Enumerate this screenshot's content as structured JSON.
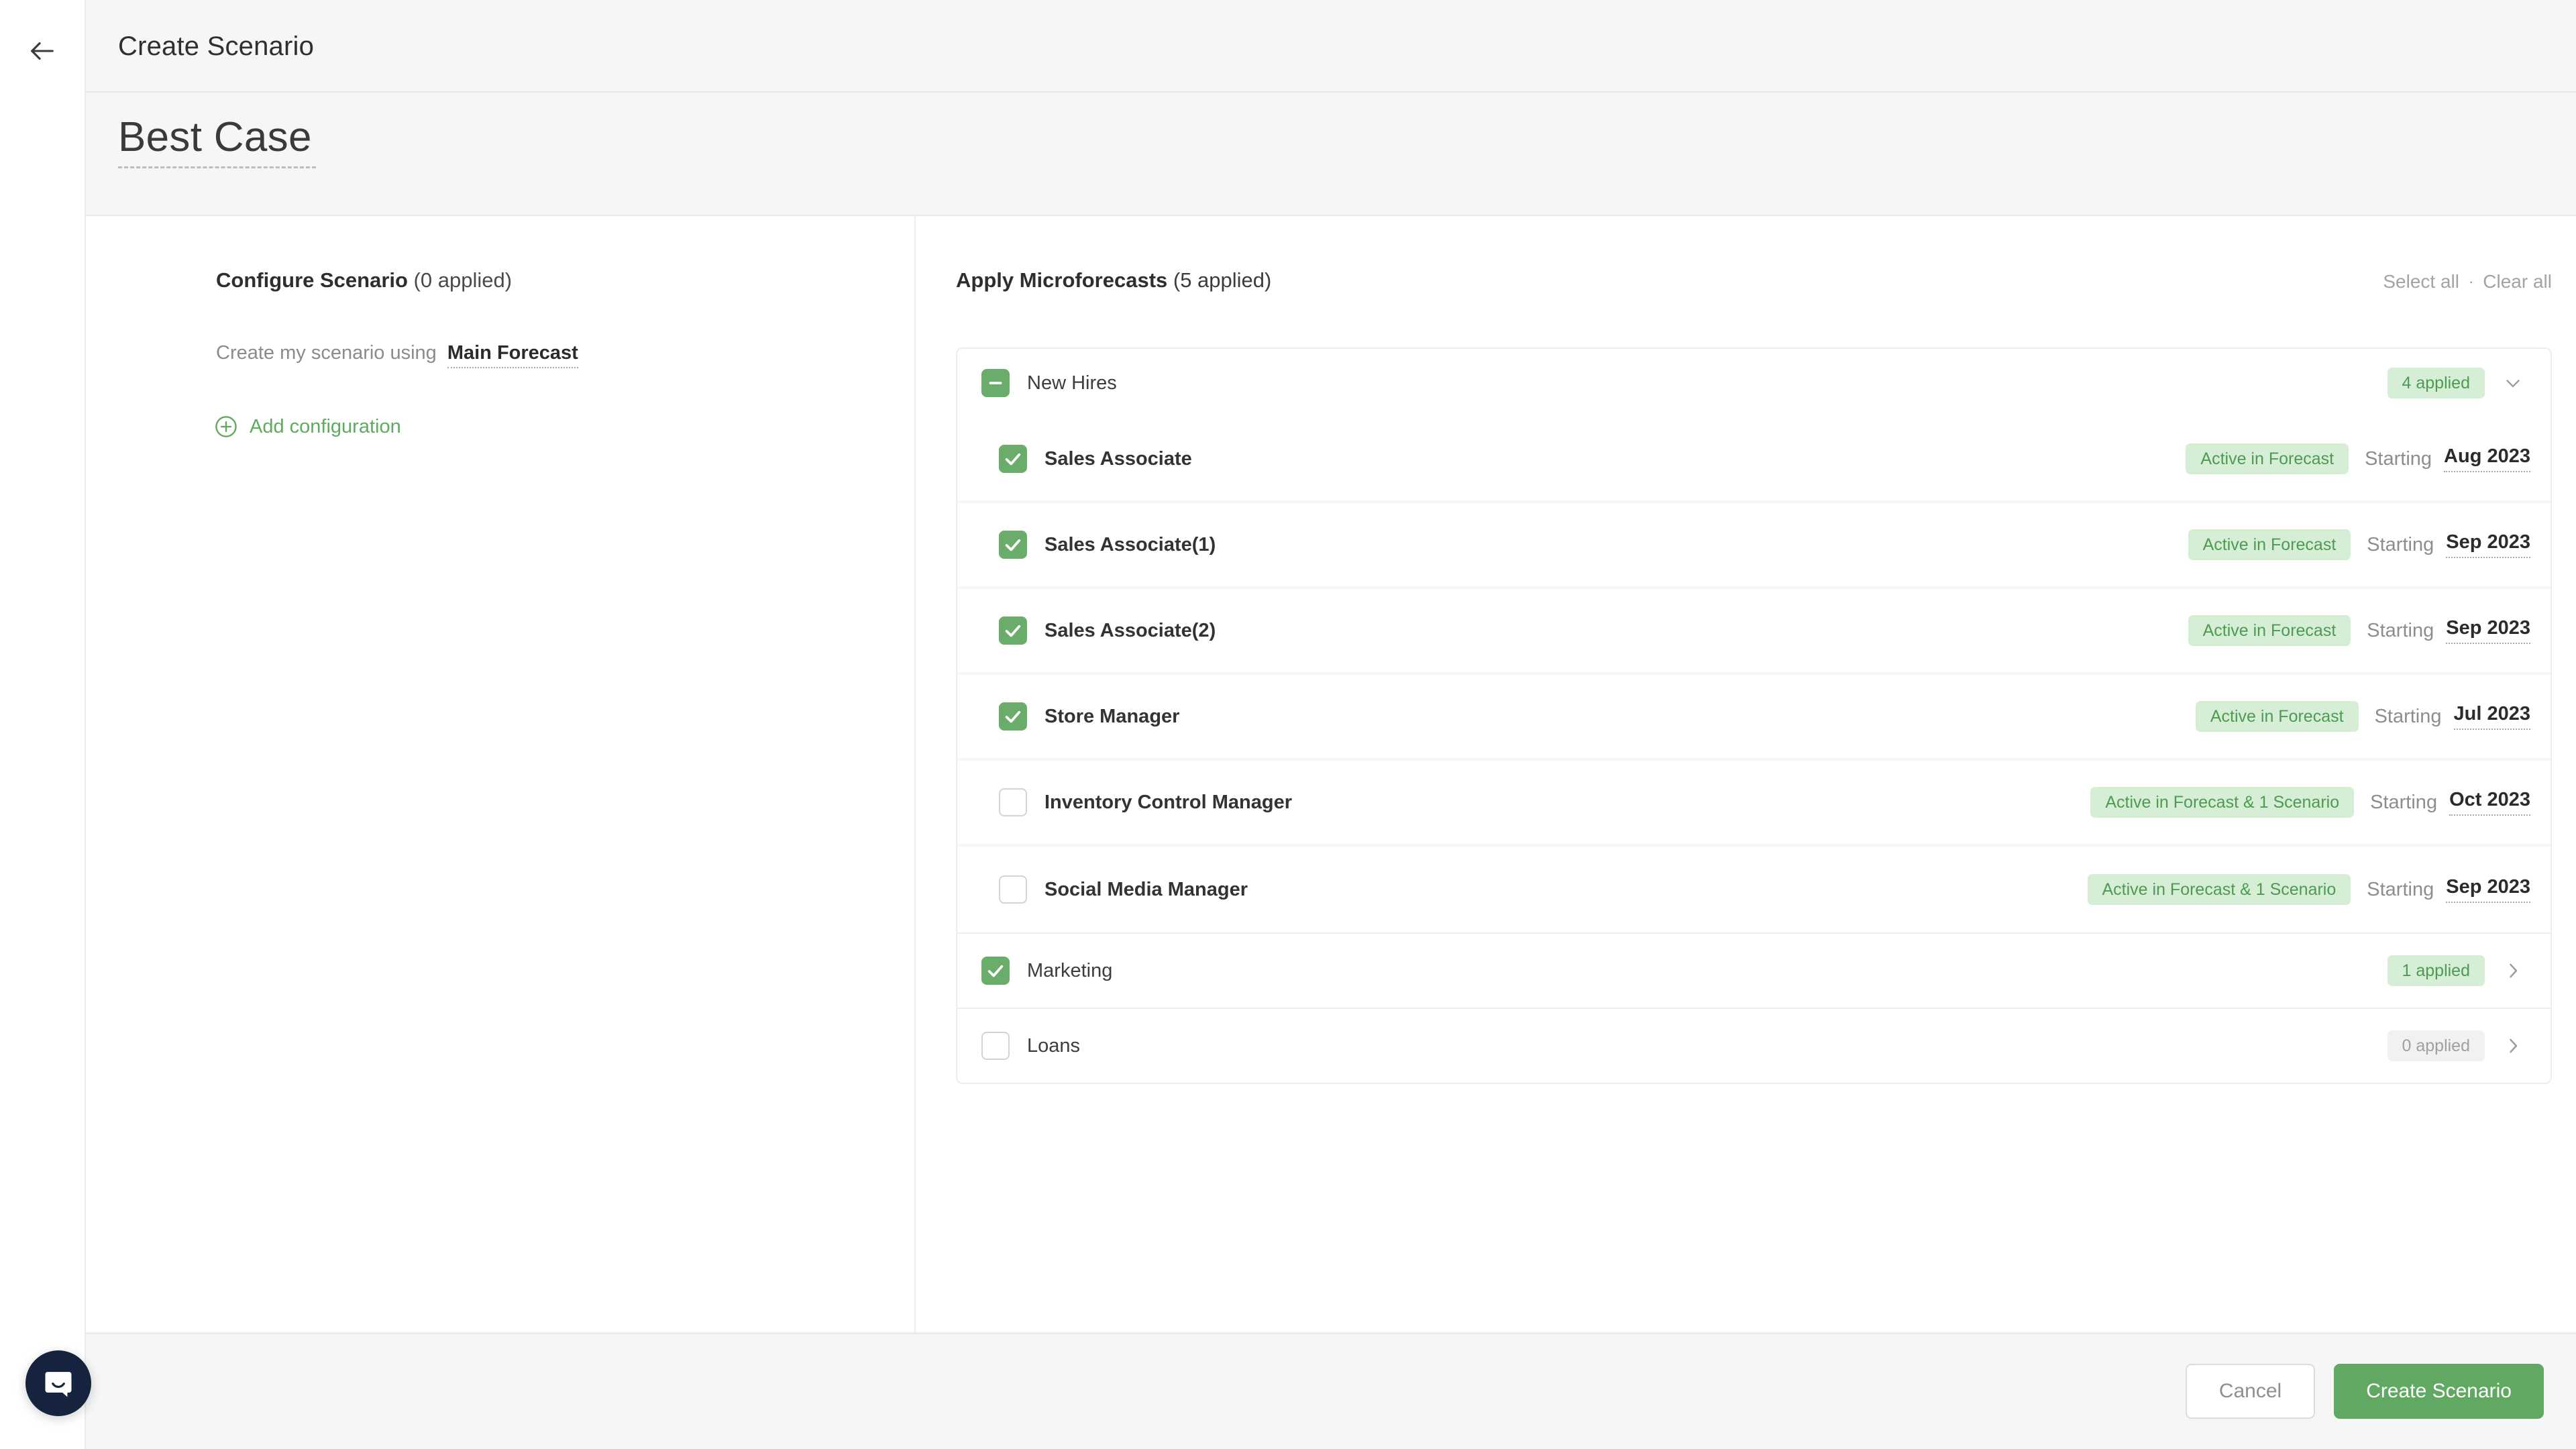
{
  "header": {
    "back_icon": "arrow-left-icon",
    "title": "Create Scenario"
  },
  "scenario": {
    "name": "Best Case"
  },
  "configure_panel": {
    "heading_bold": "Configure Scenario",
    "heading_count": " (0 applied)",
    "forecast_row_label": "Create my scenario using",
    "forecast_value": "Main Forecast",
    "add_configuration_label": "Add configuration",
    "add_icon": "plus-circle-icon"
  },
  "microforecasts_panel": {
    "heading_bold": "Apply Microforecasts",
    "heading_count": " (5 applied)",
    "select_all_label": "Select all",
    "separator": "·",
    "clear_all_label": "Clear all",
    "groups": [
      {
        "name": "New Hires",
        "checkbox_state": "indeterminate",
        "badge": "4 applied",
        "badge_tone": "green",
        "expanded": true,
        "chevron_icon": "chevron-down-icon",
        "items": [
          {
            "name": "Sales Associate",
            "checked": true,
            "status": "Active in Forecast",
            "starting_label": "Starting",
            "date": "Aug 2023"
          },
          {
            "name": "Sales Associate(1)",
            "checked": true,
            "status": "Active in Forecast",
            "starting_label": "Starting",
            "date": "Sep 2023"
          },
          {
            "name": "Sales Associate(2)",
            "checked": true,
            "status": "Active in Forecast",
            "starting_label": "Starting",
            "date": "Sep 2023"
          },
          {
            "name": "Store Manager",
            "checked": true,
            "status": "Active in Forecast",
            "starting_label": "Starting",
            "date": "Jul 2023"
          },
          {
            "name": "Inventory Control Manager",
            "checked": false,
            "status": "Active in Forecast & 1 Scenario",
            "starting_label": "Starting",
            "date": "Oct 2023"
          },
          {
            "name": "Social Media Manager",
            "checked": false,
            "status": "Active in Forecast & 1 Scenario",
            "starting_label": "Starting",
            "date": "Sep 2023"
          }
        ]
      },
      {
        "name": "Marketing",
        "checkbox_state": "checked",
        "badge": "1 applied",
        "badge_tone": "green",
        "expanded": false,
        "chevron_icon": "chevron-right-icon",
        "items": []
      },
      {
        "name": "Loans",
        "checkbox_state": "empty",
        "badge": "0 applied",
        "badge_tone": "grey",
        "expanded": false,
        "chevron_icon": "chevron-right-icon",
        "items": []
      }
    ]
  },
  "footer": {
    "cancel_label": "Cancel",
    "create_label": "Create Scenario"
  },
  "support": {
    "icon": "intercom-chat-icon"
  },
  "colors": {
    "accent_green": "#61a963",
    "checkbox_green": "#6aac6a",
    "badge_green_bg": "#d6eed6",
    "badge_green_text": "#4f9a52",
    "badge_grey_bg": "#f1f1f1",
    "badge_grey_text": "#a0a0a0",
    "page_bg": "#f5f6f6",
    "intercom_navy": "#16233f"
  }
}
